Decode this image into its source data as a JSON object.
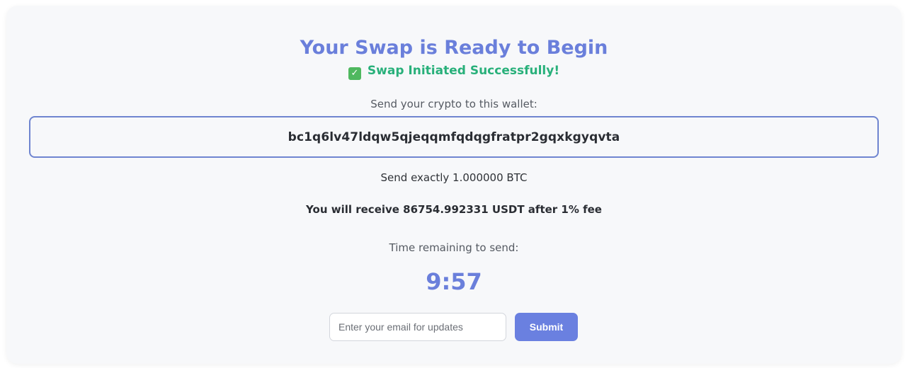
{
  "header": {
    "title": "Your Swap is Ready to Begin",
    "status": "Swap Initiated Successfully!",
    "status_icon": "check-box-icon",
    "status_icon_glyph": "✓"
  },
  "wallet": {
    "instruction": "Send your crypto to this wallet:",
    "address": "bc1q6lv47ldqw5qjeqqmfqdqgfratpr2gqxkgyqvta"
  },
  "amounts": {
    "send": "Send exactly 1.000000 BTC",
    "receive": "You will receive 86754.992331 USDT after 1% fee"
  },
  "timer": {
    "label": "Time remaining to send:",
    "value": "9:57"
  },
  "email_form": {
    "placeholder": "Enter your email for updates",
    "value": "",
    "submit_label": "Submit"
  },
  "colors": {
    "accent": "#6a7fdb",
    "success": "#28b07a",
    "button": "#6a80e0",
    "wallet_border": "#6f85d0"
  }
}
